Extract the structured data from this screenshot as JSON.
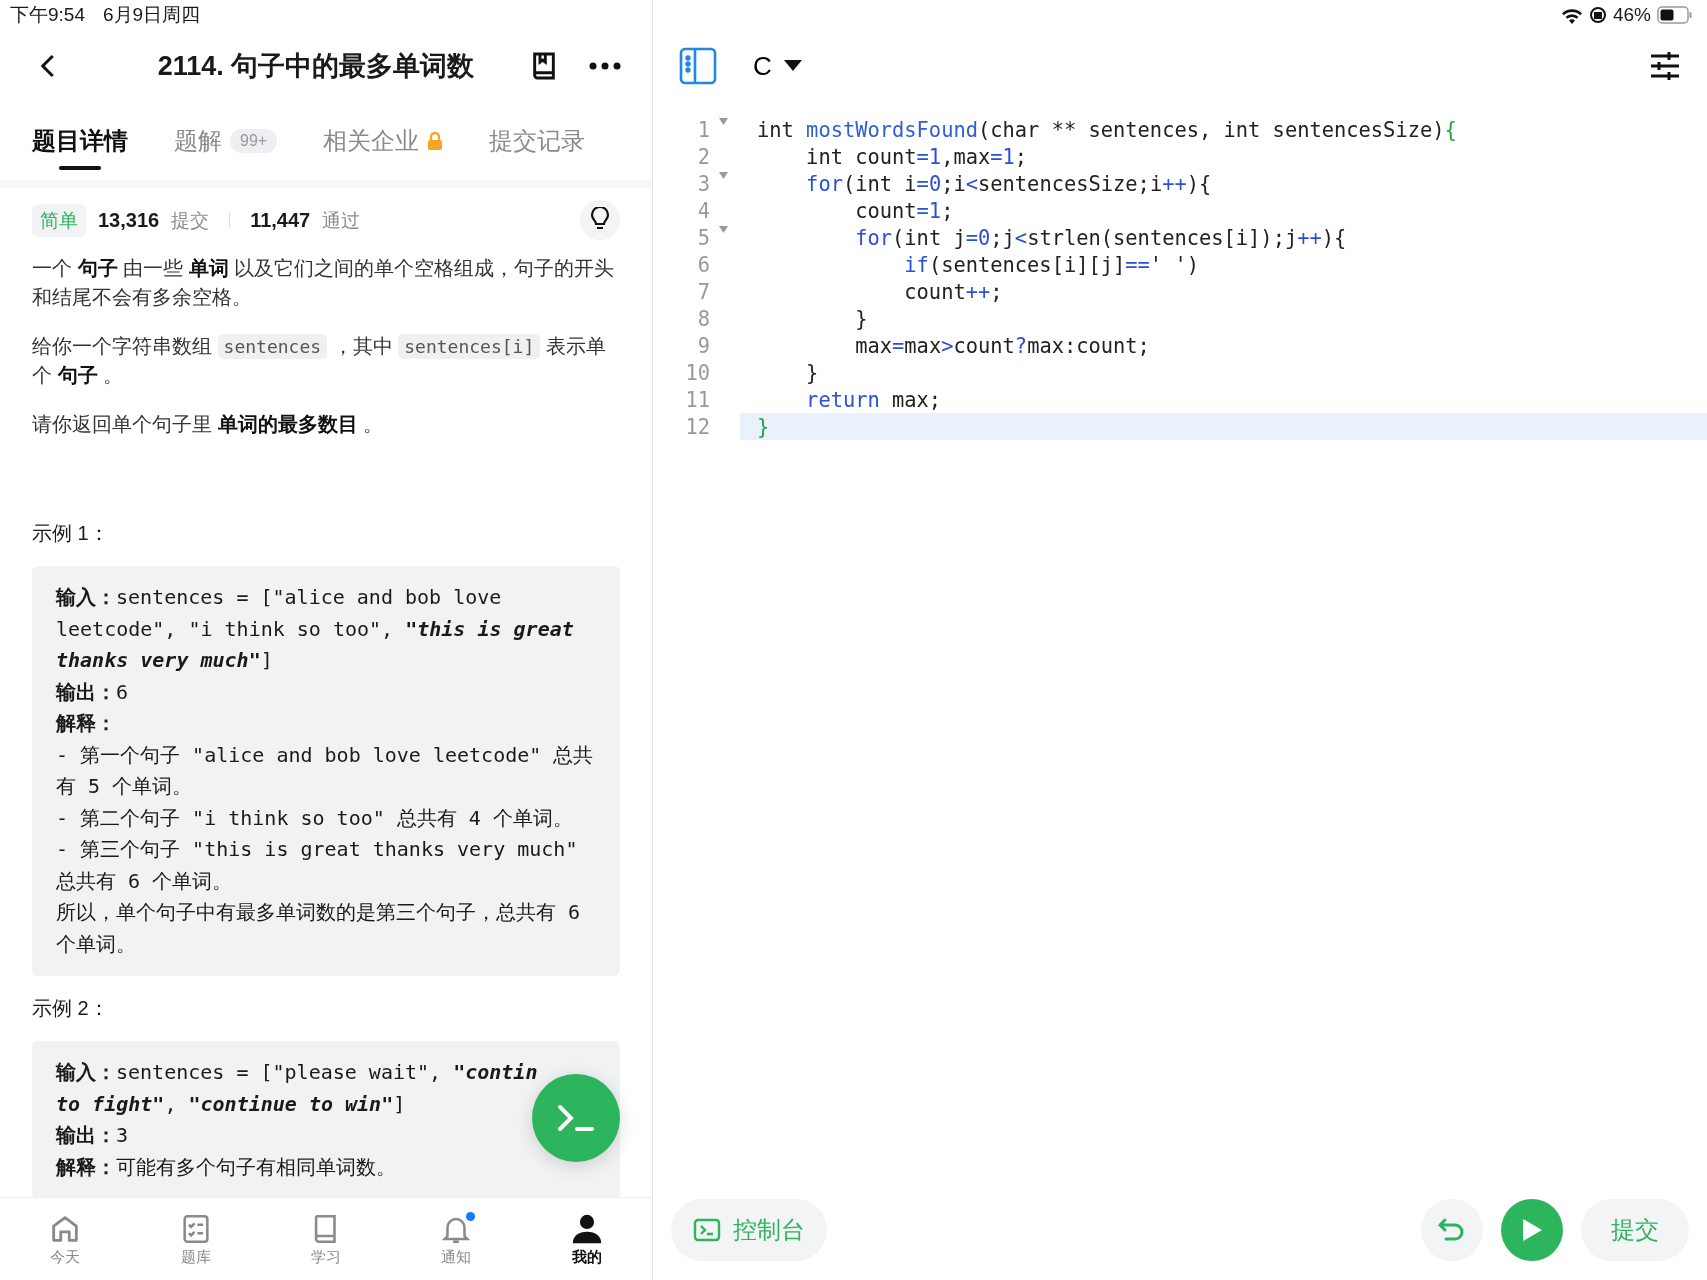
{
  "status_bar": {
    "time": "下午9:54",
    "date": "6月9日周四",
    "battery": "46%"
  },
  "header": {
    "title": "2114. 句子中的最多单词数"
  },
  "tabs": [
    {
      "label": "题目详情",
      "selected": true
    },
    {
      "label": "题解",
      "selected": false,
      "badge": "99+"
    },
    {
      "label": "相关企业",
      "selected": false,
      "locked": true
    },
    {
      "label": "提交记录",
      "selected": false
    }
  ],
  "stats": {
    "difficulty": "简单",
    "submissions": "13,316",
    "submissions_label": "提交",
    "accepted": "11,447",
    "accepted_label": "通过"
  },
  "description": [
    [
      {
        "kind": "text",
        "text": "一个 **句子** 由一些 **单词** 以及它们之间的单个空格组成，句子的开头和结尾不会有多余空格。"
      }
    ],
    [
      {
        "kind": "text",
        "text": "给你一个字符串数组 "
      },
      {
        "kind": "code",
        "text": "sentences"
      },
      {
        "kind": "text",
        "text": " ，其中 "
      },
      {
        "kind": "code",
        "text": "sentences[i]"
      },
      {
        "kind": "text",
        "text": " 表示单个 **句子** 。"
      }
    ],
    [
      {
        "kind": "text",
        "text": "请你返回单个句子里 **单词的最多数目** 。"
      }
    ]
  ],
  "examples": [
    {
      "title": "示例 1：",
      "lines": [
        [
          {
            "kind": "label",
            "text": "输入："
          },
          {
            "kind": "plain",
            "text": "sentences = [\"alice and bob love leetcode\", \"i think so too\", "
          },
          {
            "kind": "emph",
            "text": "\"this is great thanks very much\""
          },
          {
            "kind": "plain",
            "text": "]"
          }
        ],
        [
          {
            "kind": "label",
            "text": "输出："
          },
          {
            "kind": "plain",
            "text": "6"
          }
        ],
        [
          {
            "kind": "label",
            "text": "解释："
          }
        ],
        [
          {
            "kind": "plain",
            "text": "- 第一个句子 \"alice and bob love leetcode\" 总共有 5 个单词。"
          }
        ],
        [
          {
            "kind": "plain",
            "text": "- 第二个句子 \"i think so too\" 总共有 4 个单词。"
          }
        ],
        [
          {
            "kind": "plain",
            "text": "- 第三个句子 \"this is great thanks very much\" 总共有 6 个单词。"
          }
        ],
        [
          {
            "kind": "plain",
            "text": "所以，单个句子中有最多单词数的是第三个句子，总共有 6 个单词。"
          }
        ]
      ]
    },
    {
      "title": "示例 2：",
      "lines": [
        [
          {
            "kind": "label",
            "text": "输入："
          },
          {
            "kind": "plain",
            "text": "sentences = [\"please wait\", "
          },
          {
            "kind": "emph",
            "text": "\"contin"
          }
        ],
        [
          {
            "kind": "emph",
            "text": "to fight\""
          },
          {
            "kind": "plain",
            "text": ", "
          },
          {
            "kind": "emph",
            "text": "\"continue to win\""
          },
          {
            "kind": "plain",
            "text": "]"
          }
        ],
        [
          {
            "kind": "label",
            "text": "输出："
          },
          {
            "kind": "plain",
            "text": "3"
          }
        ],
        [
          {
            "kind": "label",
            "text": "解释："
          },
          {
            "kind": "plain",
            "text": "可能有多个句子有相同单词数。"
          }
        ]
      ]
    }
  ],
  "bottom_nav": [
    {
      "label": "今天",
      "selected": false
    },
    {
      "label": "题库",
      "selected": false
    },
    {
      "label": "学习",
      "selected": false
    },
    {
      "label": "通知",
      "selected": false,
      "dot": true
    },
    {
      "label": "我的",
      "selected": true
    }
  ],
  "editor": {
    "language": "C",
    "lines": [
      {
        "number": "1",
        "foldable": true,
        "current": false,
        "tokens": [
          {
            "kind": "plain",
            "text": "int "
          },
          {
            "kind": "fn",
            "text": "mostWordsFound"
          },
          {
            "kind": "plain",
            "text": "(char ** sentences, int sentencesSize)"
          },
          {
            "kind": "brace",
            "text": "{"
          }
        ]
      },
      {
        "number": "2",
        "foldable": false,
        "current": false,
        "tokens": [
          {
            "kind": "plain",
            "text": "    int count"
          },
          {
            "kind": "op",
            "text": "=1"
          },
          {
            "kind": "plain",
            "text": ",max"
          },
          {
            "kind": "op",
            "text": "=1"
          },
          {
            "kind": "plain",
            "text": ";"
          }
        ]
      },
      {
        "number": "3",
        "foldable": true,
        "current": false,
        "tokens": [
          {
            "kind": "kw",
            "text": "    for"
          },
          {
            "kind": "plain",
            "text": "(int i"
          },
          {
            "kind": "op",
            "text": "=0"
          },
          {
            "kind": "plain",
            "text": ";i"
          },
          {
            "kind": "op",
            "text": "<"
          },
          {
            "kind": "plain",
            "text": "sentencesSize;i"
          },
          {
            "kind": "op",
            "text": "++"
          },
          {
            "kind": "plain",
            "text": "){"
          }
        ]
      },
      {
        "number": "4",
        "foldable": false,
        "current": false,
        "tokens": [
          {
            "kind": "plain",
            "text": "        count"
          },
          {
            "kind": "op",
            "text": "=1"
          },
          {
            "kind": "plain",
            "text": ";"
          }
        ]
      },
      {
        "number": "5",
        "foldable": true,
        "current": false,
        "tokens": [
          {
            "kind": "kw",
            "text": "        for"
          },
          {
            "kind": "plain",
            "text": "(int j"
          },
          {
            "kind": "op",
            "text": "=0"
          },
          {
            "kind": "plain",
            "text": ";j"
          },
          {
            "kind": "op",
            "text": "<"
          },
          {
            "kind": "plain",
            "text": "strlen(sentences[i]);j"
          },
          {
            "kind": "op",
            "text": "++"
          },
          {
            "kind": "plain",
            "text": "){"
          }
        ]
      },
      {
        "number": "6",
        "foldable": false,
        "current": false,
        "tokens": [
          {
            "kind": "kw",
            "text": "            if"
          },
          {
            "kind": "plain",
            "text": "(sentences[i][j]"
          },
          {
            "kind": "op",
            "text": "=="
          },
          {
            "kind": "plain",
            "text": "' ')"
          }
        ]
      },
      {
        "number": "7",
        "foldable": false,
        "current": false,
        "tokens": [
          {
            "kind": "plain",
            "text": "            count"
          },
          {
            "kind": "op",
            "text": "++"
          },
          {
            "kind": "plain",
            "text": ";"
          }
        ]
      },
      {
        "number": "8",
        "foldable": false,
        "current": false,
        "tokens": [
          {
            "kind": "plain",
            "text": "        }"
          }
        ]
      },
      {
        "number": "9",
        "foldable": false,
        "current": false,
        "tokens": [
          {
            "kind": "plain",
            "text": "        max"
          },
          {
            "kind": "op",
            "text": "="
          },
          {
            "kind": "plain",
            "text": "max"
          },
          {
            "kind": "op",
            "text": ">"
          },
          {
            "kind": "plain",
            "text": "count"
          },
          {
            "kind": "op",
            "text": "?"
          },
          {
            "kind": "plain",
            "text": "max:count;"
          }
        ]
      },
      {
        "number": "10",
        "foldable": false,
        "current": false,
        "tokens": [
          {
            "kind": "plain",
            "text": "    }"
          }
        ]
      },
      {
        "number": "11",
        "foldable": false,
        "current": false,
        "tokens": [
          {
            "kind": "kw",
            "text": "    return"
          },
          {
            "kind": "plain",
            "text": " max;"
          }
        ]
      },
      {
        "number": "12",
        "foldable": false,
        "current": true,
        "tokens": [
          {
            "kind": "brace",
            "text": "}"
          }
        ]
      }
    ]
  },
  "footer": {
    "console": "控制台",
    "submit": "提交"
  }
}
